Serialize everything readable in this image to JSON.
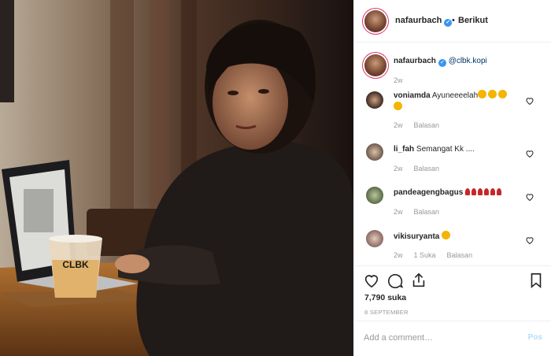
{
  "post": {
    "author": "nafaurbach",
    "follow_dot": "•",
    "follow_label": "Berikut",
    "mention": "@clbk.kopi",
    "age": "2w",
    "likes": "7,790 suka",
    "date": "8 SEPTEMBER",
    "cup_text": "CLBK"
  },
  "comments": [
    {
      "user": "voniamda",
      "text": "Ayuneeeelah",
      "age": "2w",
      "reply": "Balasan",
      "likes": ""
    },
    {
      "user": "li_fah",
      "text": "Semangat Kk ....",
      "age": "2w",
      "reply": "Balasan",
      "likes": ""
    },
    {
      "user": "pandeagengbagus",
      "text": "",
      "age": "2w",
      "reply": "Balasan",
      "likes": ""
    },
    {
      "user": "vikisuryanta",
      "text": "",
      "age": "2w",
      "reply": "Balasan",
      "likes": "1 Suka"
    }
  ],
  "add_comment": {
    "placeholder": "Add a comment…",
    "post_label": "Pos"
  },
  "icons": {
    "like": "heart-icon",
    "comment": "comment-icon",
    "share": "share-icon",
    "save": "bookmark-icon"
  },
  "colors": {
    "link": "#003569",
    "verified": "#3897f0",
    "muted": "#999999",
    "post_disabled": "#b2dffc"
  }
}
